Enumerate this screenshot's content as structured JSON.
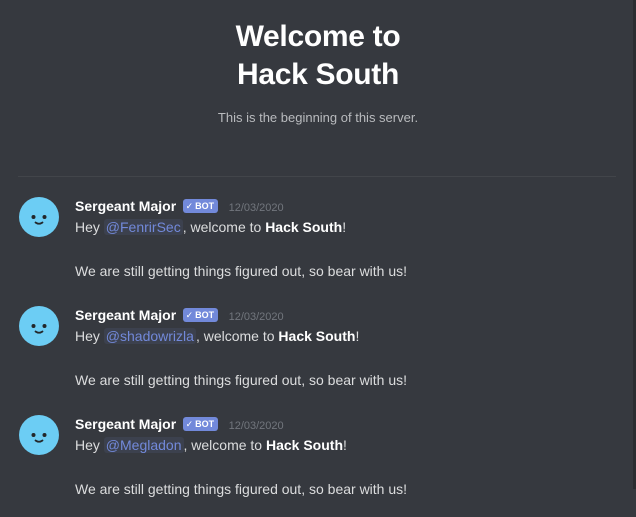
{
  "welcome": {
    "title": "Welcome to Hack South",
    "subtitle": "This is the beginning of this server."
  },
  "messages": [
    {
      "author": "Sergeant Major",
      "bot_tag": "BOT",
      "bot_check": "✓",
      "timestamp": "12/03/2020",
      "line1_prefix": "Hey",
      "mention": "@FenrirSec",
      "line1_middle": ", welcome to",
      "server_name": "Hack South",
      "line1_suffix": "!",
      "line2": "We are still getting things figured out, so bear with us!"
    },
    {
      "author": "Sergeant Major",
      "bot_tag": "BOT",
      "bot_check": "✓",
      "timestamp": "12/03/2020",
      "line1_prefix": "Hey",
      "mention": "@shadowrizla",
      "line1_middle": ", welcome to",
      "server_name": "Hack South",
      "line1_suffix": "!",
      "line2": "We are still getting things figured out, so bear with us!"
    },
    {
      "author": "Sergeant Major",
      "bot_tag": "BOT",
      "bot_check": "✓",
      "timestamp": "12/03/2020",
      "line1_prefix": "Hey",
      "mention": "@Megladon",
      "line1_middle": ", welcome to",
      "server_name": "Hack South",
      "line1_suffix": "!",
      "line2": "We are still getting things figured out, so bear with us!"
    }
  ],
  "colors": {
    "background": "#36393f",
    "avatar": "#6ccdf4",
    "bot_tag": "#7289da",
    "mention": "#7289da"
  }
}
